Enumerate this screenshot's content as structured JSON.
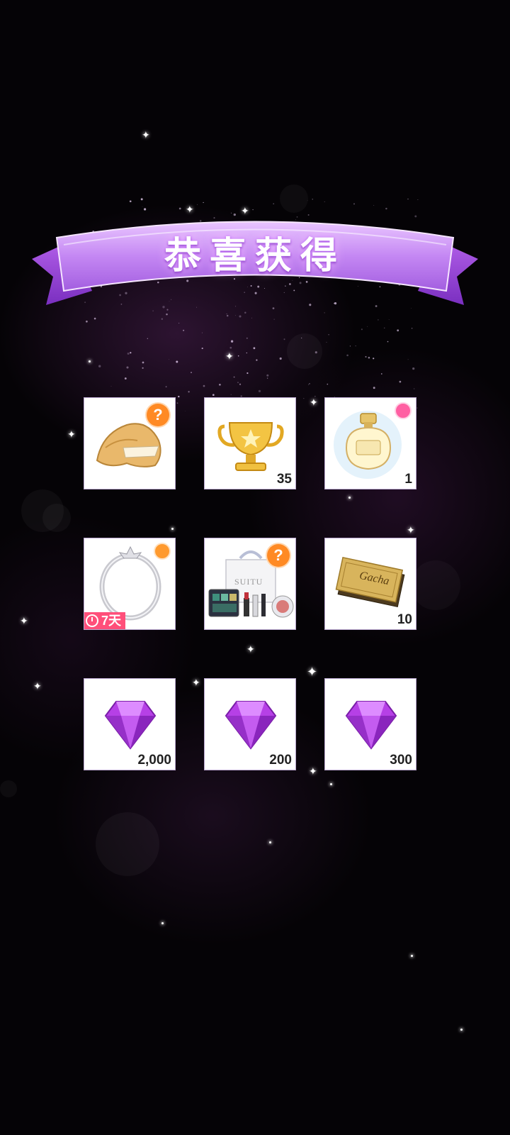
{
  "banner": {
    "title": "恭喜获得"
  },
  "rewards": [
    {
      "item": "fortune-cookie",
      "badge": "?",
      "quantity": ""
    },
    {
      "item": "gold-trophy",
      "badge": "",
      "quantity": "35"
    },
    {
      "item": "perfume-bottle",
      "badge": "perfume",
      "quantity": "1"
    },
    {
      "item": "silver-ring-frame",
      "badge": "avatar",
      "quantity": "",
      "timer": "7天"
    },
    {
      "item": "cosmetics-bundle",
      "badge": "?",
      "quantity": ""
    },
    {
      "item": "gacha-ticket",
      "badge": "",
      "quantity": "10",
      "ticket_text": "Gacha"
    },
    {
      "item": "purple-diamond",
      "badge": "",
      "quantity": "2,000"
    },
    {
      "item": "purple-diamond",
      "badge": "",
      "quantity": "200"
    },
    {
      "item": "purple-diamond",
      "badge": "",
      "quantity": "300"
    }
  ],
  "cosmetics_label": "SUITU",
  "colors": {
    "banner": "#b06fe6",
    "badge_orange": "#ff8a24",
    "timer_pink": "#ff4f7a",
    "diamond": "#b640e6"
  }
}
